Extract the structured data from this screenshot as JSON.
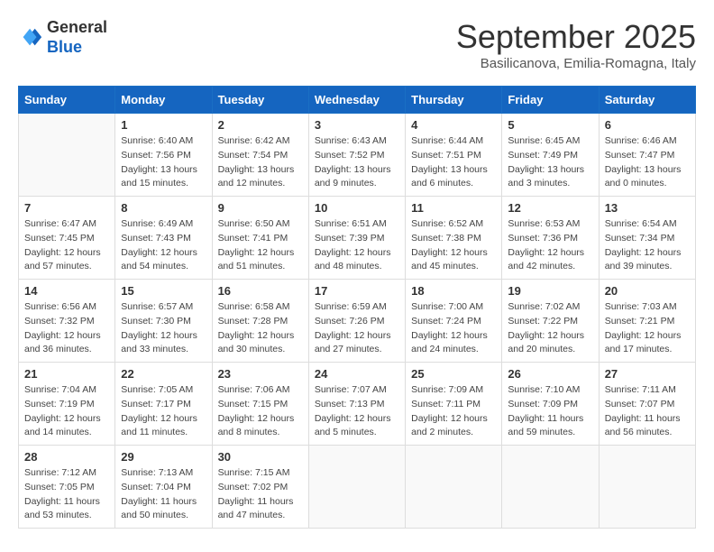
{
  "header": {
    "logo": {
      "line1": "General",
      "line2": "Blue"
    },
    "title": "September 2025",
    "subtitle": "Basilicanova, Emilia-Romagna, Italy"
  },
  "calendar": {
    "days_of_week": [
      "Sunday",
      "Monday",
      "Tuesday",
      "Wednesday",
      "Thursday",
      "Friday",
      "Saturday"
    ],
    "weeks": [
      [
        {
          "day": "",
          "sunrise": "",
          "sunset": "",
          "daylight": ""
        },
        {
          "day": "1",
          "sunrise": "Sunrise: 6:40 AM",
          "sunset": "Sunset: 7:56 PM",
          "daylight": "Daylight: 13 hours and 15 minutes."
        },
        {
          "day": "2",
          "sunrise": "Sunrise: 6:42 AM",
          "sunset": "Sunset: 7:54 PM",
          "daylight": "Daylight: 13 hours and 12 minutes."
        },
        {
          "day": "3",
          "sunrise": "Sunrise: 6:43 AM",
          "sunset": "Sunset: 7:52 PM",
          "daylight": "Daylight: 13 hours and 9 minutes."
        },
        {
          "day": "4",
          "sunrise": "Sunrise: 6:44 AM",
          "sunset": "Sunset: 7:51 PM",
          "daylight": "Daylight: 13 hours and 6 minutes."
        },
        {
          "day": "5",
          "sunrise": "Sunrise: 6:45 AM",
          "sunset": "Sunset: 7:49 PM",
          "daylight": "Daylight: 13 hours and 3 minutes."
        },
        {
          "day": "6",
          "sunrise": "Sunrise: 6:46 AM",
          "sunset": "Sunset: 7:47 PM",
          "daylight": "Daylight: 13 hours and 0 minutes."
        }
      ],
      [
        {
          "day": "7",
          "sunrise": "Sunrise: 6:47 AM",
          "sunset": "Sunset: 7:45 PM",
          "daylight": "Daylight: 12 hours and 57 minutes."
        },
        {
          "day": "8",
          "sunrise": "Sunrise: 6:49 AM",
          "sunset": "Sunset: 7:43 PM",
          "daylight": "Daylight: 12 hours and 54 minutes."
        },
        {
          "day": "9",
          "sunrise": "Sunrise: 6:50 AM",
          "sunset": "Sunset: 7:41 PM",
          "daylight": "Daylight: 12 hours and 51 minutes."
        },
        {
          "day": "10",
          "sunrise": "Sunrise: 6:51 AM",
          "sunset": "Sunset: 7:39 PM",
          "daylight": "Daylight: 12 hours and 48 minutes."
        },
        {
          "day": "11",
          "sunrise": "Sunrise: 6:52 AM",
          "sunset": "Sunset: 7:38 PM",
          "daylight": "Daylight: 12 hours and 45 minutes."
        },
        {
          "day": "12",
          "sunrise": "Sunrise: 6:53 AM",
          "sunset": "Sunset: 7:36 PM",
          "daylight": "Daylight: 12 hours and 42 minutes."
        },
        {
          "day": "13",
          "sunrise": "Sunrise: 6:54 AM",
          "sunset": "Sunset: 7:34 PM",
          "daylight": "Daylight: 12 hours and 39 minutes."
        }
      ],
      [
        {
          "day": "14",
          "sunrise": "Sunrise: 6:56 AM",
          "sunset": "Sunset: 7:32 PM",
          "daylight": "Daylight: 12 hours and 36 minutes."
        },
        {
          "day": "15",
          "sunrise": "Sunrise: 6:57 AM",
          "sunset": "Sunset: 7:30 PM",
          "daylight": "Daylight: 12 hours and 33 minutes."
        },
        {
          "day": "16",
          "sunrise": "Sunrise: 6:58 AM",
          "sunset": "Sunset: 7:28 PM",
          "daylight": "Daylight: 12 hours and 30 minutes."
        },
        {
          "day": "17",
          "sunrise": "Sunrise: 6:59 AM",
          "sunset": "Sunset: 7:26 PM",
          "daylight": "Daylight: 12 hours and 27 minutes."
        },
        {
          "day": "18",
          "sunrise": "Sunrise: 7:00 AM",
          "sunset": "Sunset: 7:24 PM",
          "daylight": "Daylight: 12 hours and 24 minutes."
        },
        {
          "day": "19",
          "sunrise": "Sunrise: 7:02 AM",
          "sunset": "Sunset: 7:22 PM",
          "daylight": "Daylight: 12 hours and 20 minutes."
        },
        {
          "day": "20",
          "sunrise": "Sunrise: 7:03 AM",
          "sunset": "Sunset: 7:21 PM",
          "daylight": "Daylight: 12 hours and 17 minutes."
        }
      ],
      [
        {
          "day": "21",
          "sunrise": "Sunrise: 7:04 AM",
          "sunset": "Sunset: 7:19 PM",
          "daylight": "Daylight: 12 hours and 14 minutes."
        },
        {
          "day": "22",
          "sunrise": "Sunrise: 7:05 AM",
          "sunset": "Sunset: 7:17 PM",
          "daylight": "Daylight: 12 hours and 11 minutes."
        },
        {
          "day": "23",
          "sunrise": "Sunrise: 7:06 AM",
          "sunset": "Sunset: 7:15 PM",
          "daylight": "Daylight: 12 hours and 8 minutes."
        },
        {
          "day": "24",
          "sunrise": "Sunrise: 7:07 AM",
          "sunset": "Sunset: 7:13 PM",
          "daylight": "Daylight: 12 hours and 5 minutes."
        },
        {
          "day": "25",
          "sunrise": "Sunrise: 7:09 AM",
          "sunset": "Sunset: 7:11 PM",
          "daylight": "Daylight: 12 hours and 2 minutes."
        },
        {
          "day": "26",
          "sunrise": "Sunrise: 7:10 AM",
          "sunset": "Sunset: 7:09 PM",
          "daylight": "Daylight: 11 hours and 59 minutes."
        },
        {
          "day": "27",
          "sunrise": "Sunrise: 7:11 AM",
          "sunset": "Sunset: 7:07 PM",
          "daylight": "Daylight: 11 hours and 56 minutes."
        }
      ],
      [
        {
          "day": "28",
          "sunrise": "Sunrise: 7:12 AM",
          "sunset": "Sunset: 7:05 PM",
          "daylight": "Daylight: 11 hours and 53 minutes."
        },
        {
          "day": "29",
          "sunrise": "Sunrise: 7:13 AM",
          "sunset": "Sunset: 7:04 PM",
          "daylight": "Daylight: 11 hours and 50 minutes."
        },
        {
          "day": "30",
          "sunrise": "Sunrise: 7:15 AM",
          "sunset": "Sunset: 7:02 PM",
          "daylight": "Daylight: 11 hours and 47 minutes."
        },
        {
          "day": "",
          "sunrise": "",
          "sunset": "",
          "daylight": ""
        },
        {
          "day": "",
          "sunrise": "",
          "sunset": "",
          "daylight": ""
        },
        {
          "day": "",
          "sunrise": "",
          "sunset": "",
          "daylight": ""
        },
        {
          "day": "",
          "sunrise": "",
          "sunset": "",
          "daylight": ""
        }
      ]
    ]
  }
}
